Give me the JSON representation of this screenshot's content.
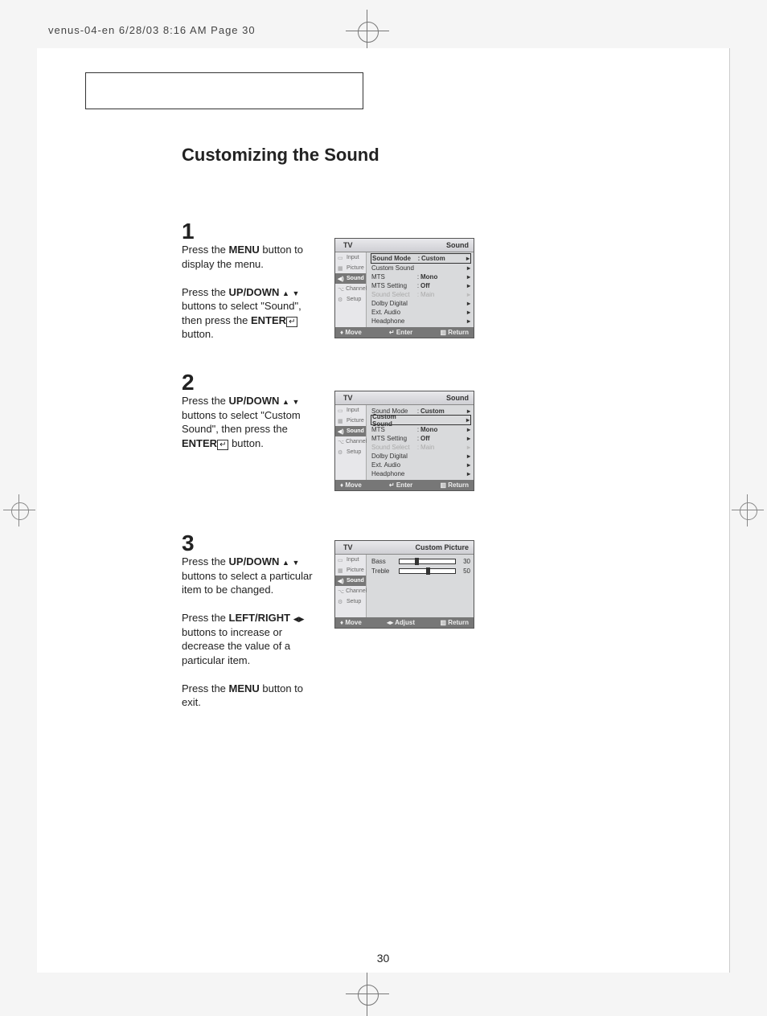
{
  "header": "venus-04-en  6/28/03 8:16 AM  Page 30",
  "title": "Customizing the Sound",
  "page_number": "30",
  "steps": {
    "s1": {
      "num": "1",
      "t1a": "Press the ",
      "t1b": "MENU",
      "t1c": " button to display the menu.",
      "t2a": "Press the ",
      "t2b": "UP/DOWN",
      "t2d": " buttons to select \"Sound\", then press the ",
      "t2e": "ENTER",
      "t2g": " button."
    },
    "s2": {
      "num": "2",
      "t1a": "Press the ",
      "t1b": "UP/DOWN",
      "t1d": " buttons to select \"Custom Sound\", then press the ",
      "t1e": "ENTER",
      "t1g": "  button."
    },
    "s3": {
      "num": "3",
      "t1a": "Press the ",
      "t1b": "UP/DOWN",
      "t1d": " buttons to select a particular item to be changed.",
      "t2a": "Press the ",
      "t2b": "LEFT/RIGHT",
      "t2d": " buttons to increase or decrease the value of a particular item.",
      "t3a": "Press the ",
      "t3b": "MENU",
      "t3c": " button to exit."
    }
  },
  "osd": {
    "tv": "TV",
    "sound_title": "Sound",
    "custom_picture_title": "Custom Picture",
    "side": {
      "input": "Input",
      "picture": "Picture",
      "sound": "Sound",
      "channel": "Channel",
      "setup": "Setup"
    },
    "rows": {
      "sound_mode": "Sound Mode",
      "custom_sound": "Custom Sound",
      "mts": "MTS",
      "mts_setting": "MTS Setting",
      "sound_select": "Sound Select",
      "dolby_digital": "Dolby Digital",
      "ext_audio": "Ext. Audio",
      "headphone": "Headphone",
      "custom": "Custom",
      "mono": "Mono",
      "off": "Off",
      "main": "Main",
      "bass": "Bass",
      "treble": "Treble"
    },
    "foot": {
      "move": "Move",
      "enter": "Enter",
      "adjust": "Adjust",
      "return": "Return"
    },
    "vals": {
      "bass": "30",
      "treble": "50"
    }
  }
}
